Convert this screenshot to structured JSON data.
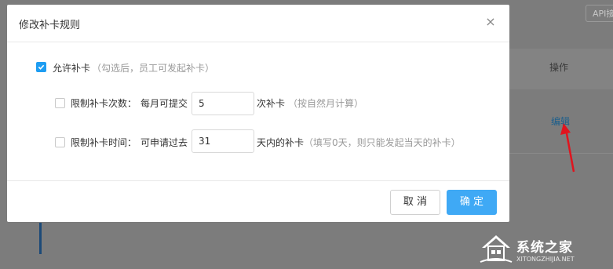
{
  "background": {
    "api_button_label": "API接",
    "column_header_action": "操作",
    "edit_link": "编辑"
  },
  "modal": {
    "title": "修改补卡规则",
    "close_symbol": "×",
    "allow_makeup": {
      "checked": true,
      "label": "允许补卡",
      "hint": "（勾选后，员工可发起补卡）"
    },
    "limit_count": {
      "checked": false,
      "label": "限制补卡次数：",
      "prefix": "每月可提交",
      "value": "5",
      "suffix": "次补卡",
      "hint": "（按自然月计算）"
    },
    "limit_time": {
      "checked": false,
      "label": "限制补卡时间：",
      "prefix": "可申请过去",
      "value": "31",
      "suffix": "天内的补卡",
      "hint": "（填写0天，则只能发起当天的补卡）"
    },
    "footer": {
      "cancel_label": "取 消",
      "confirm_label": "确 定"
    }
  },
  "watermark": {
    "brand_text": "系统之家",
    "url_text": "XITONGZHIJIA.NET"
  },
  "colors": {
    "accent": "#3fa9f5",
    "checkbox_checked": "#1e9df2",
    "overlay": "#7c7c7c",
    "arrow": "#e0141e"
  }
}
